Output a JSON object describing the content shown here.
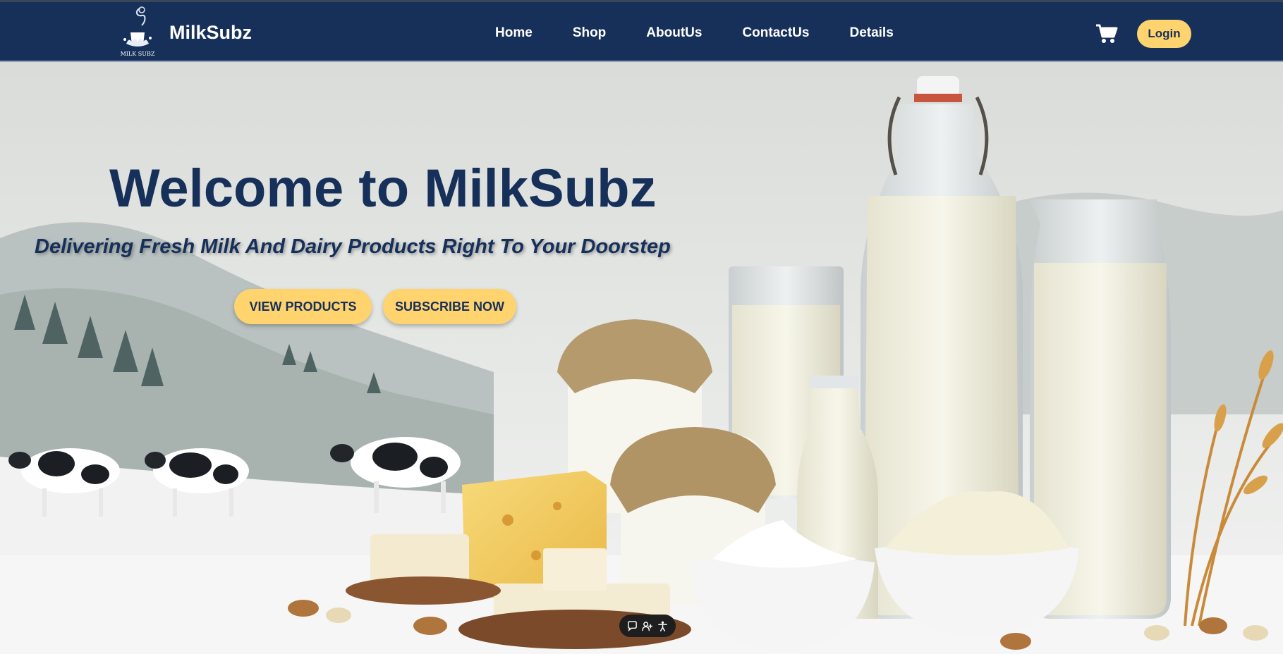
{
  "brand": {
    "name": "MilkSubz",
    "logo_text": "MILK SUBZ"
  },
  "nav": {
    "items": [
      {
        "label": "Home"
      },
      {
        "label": "Shop"
      },
      {
        "label": "AboutUs"
      },
      {
        "label": "ContactUs"
      },
      {
        "label": "Details"
      }
    ],
    "cart_icon": "shopping-cart-icon",
    "login_label": "Login"
  },
  "hero": {
    "title": "Welcome to MilkSubz",
    "subtitle": "Delivering Fresh Milk And Dairy Products Right To Your Doorstep",
    "buttons": {
      "view_products": "VIEW PRODUCTS",
      "subscribe_now": "SUBSCRIBE NOW"
    },
    "background_image": "dairy products with cows in misty valley"
  },
  "widget": {
    "icons": [
      "chat-icon",
      "add-user-icon",
      "accessibility-icon"
    ]
  },
  "colors": {
    "navbar": "#16305a",
    "accent": "#ffd36e",
    "title_text": "#16305a"
  }
}
